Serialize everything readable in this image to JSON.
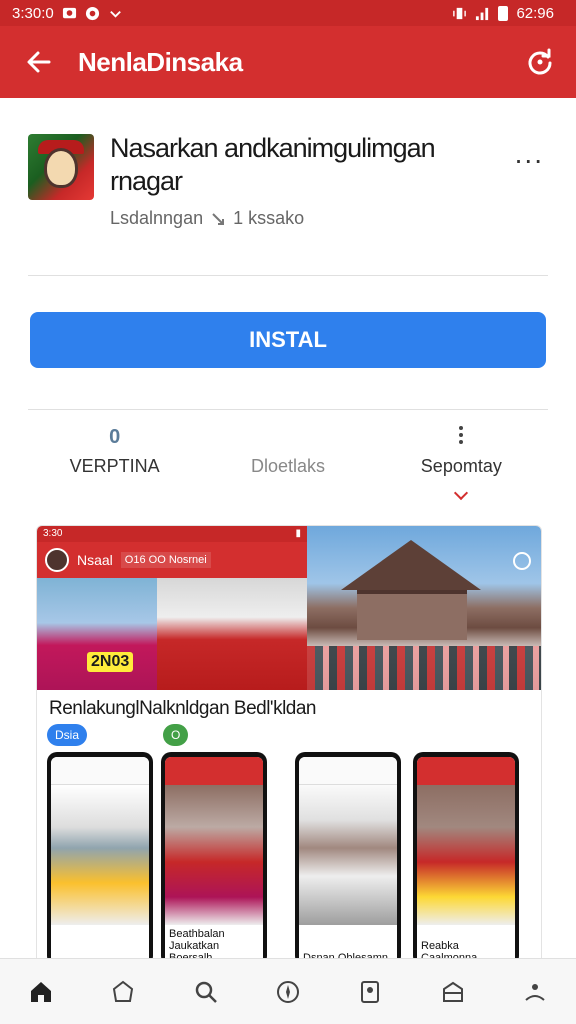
{
  "status_bar": {
    "time_left": "3:30:0",
    "time_right": "62:96"
  },
  "app_bar": {
    "title": "NenlaDinsaka"
  },
  "app": {
    "name": "Nasarkan andkanimgulimgan rnagar",
    "more": "...",
    "developer": "Lsdalnngan",
    "size": "1 kssako"
  },
  "install": {
    "label": "INSTAL"
  },
  "tabs": [
    {
      "top": "0",
      "label": "VERPTINA"
    },
    {
      "top": "",
      "label": "Dloetlaks"
    },
    {
      "top": "",
      "label": "Sepomtay"
    }
  ],
  "gallery": {
    "mini_status_time": "3:30",
    "mini_title": "Nsaal",
    "mini_chip": "O16 OO Nosrnei",
    "photo_badge": "2N03",
    "caption": "RenlakunglNalknldgan Bedl'kldan",
    "chip_blue": "Dsia",
    "chip_green": "O",
    "screens": [
      {
        "caption": ""
      },
      {
        "caption": "Beathbalan Jaukatkan Boersalh"
      },
      {
        "caption": "Dsnan Oblesamn"
      },
      {
        "caption": "Reabka Caalmonna"
      }
    ]
  },
  "colors": {
    "primary_red": "#d32f2f",
    "install_blue": "#2f80ed"
  },
  "bottom_nav": [
    "home-icon",
    "store-icon",
    "search-icon",
    "compass-icon",
    "bookmark-icon",
    "library-icon",
    "account-icon"
  ]
}
